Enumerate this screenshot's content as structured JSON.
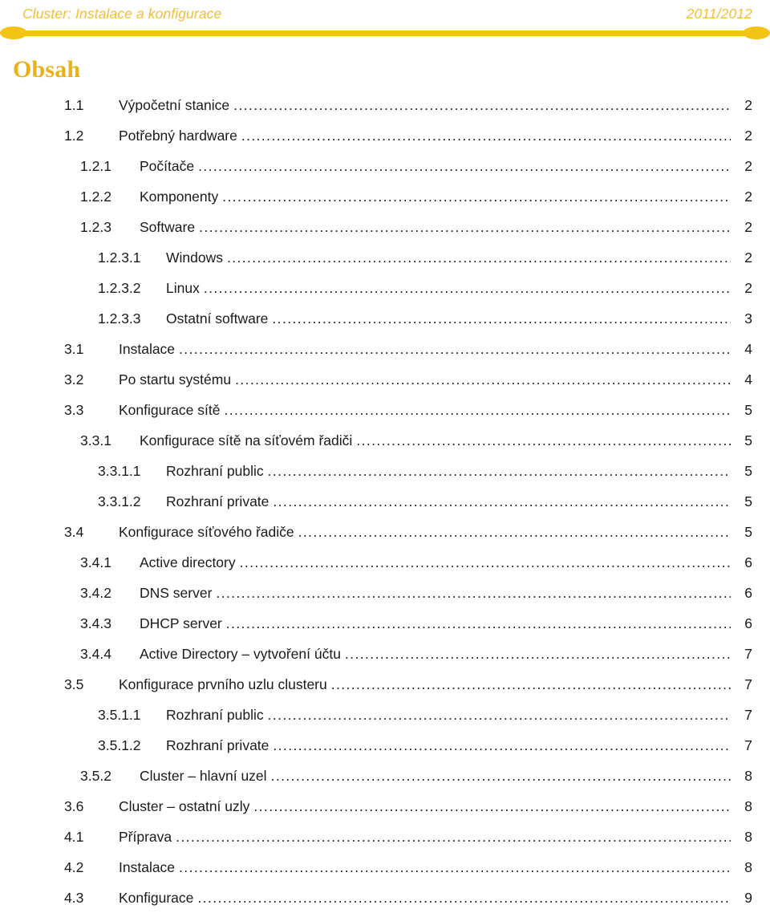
{
  "header": {
    "title": "Cluster: Instalace a konfigurace",
    "year": "2011/2012"
  },
  "toc": {
    "heading": "Obsah",
    "dot_leader": "........................................................................................................................................................................",
    "entries": [
      {
        "number": "1.1",
        "label": "Výpočetní stanice",
        "page": "2",
        "level": 2
      },
      {
        "number": "1.2",
        "label": "Potřebný hardware",
        "page": "2",
        "level": 2
      },
      {
        "number": "1.2.1",
        "label": "Počítače",
        "page": "2",
        "level": 3
      },
      {
        "number": "1.2.2",
        "label": "Komponenty",
        "page": "2",
        "level": 3
      },
      {
        "number": "1.2.3",
        "label": "Software",
        "page": "2",
        "level": 3
      },
      {
        "number": "1.2.3.1",
        "label": "Windows",
        "page": "2",
        "level": 4
      },
      {
        "number": "1.2.3.2",
        "label": "Linux",
        "page": "2",
        "level": 4
      },
      {
        "number": "1.2.3.3",
        "label": "Ostatní software",
        "page": "3",
        "level": 4
      },
      {
        "number": "3.1",
        "label": "Instalace",
        "page": "4",
        "level": 2
      },
      {
        "number": "3.2",
        "label": "Po startu systému",
        "page": "4",
        "level": 2
      },
      {
        "number": "3.3",
        "label": "Konfigurace sítě",
        "page": "5",
        "level": 2
      },
      {
        "number": "3.3.1",
        "label": "Konfigurace sítě na síťovém řadiči",
        "page": "5",
        "level": 3
      },
      {
        "number": "3.3.1.1",
        "label": "Rozhraní public",
        "page": "5",
        "level": 4
      },
      {
        "number": "3.3.1.2",
        "label": "Rozhraní private",
        "page": "5",
        "level": 4
      },
      {
        "number": "3.4",
        "label": "Konfigurace síťového řadiče",
        "page": "5",
        "level": 2
      },
      {
        "number": "3.4.1",
        "label": "Active directory",
        "page": "6",
        "level": 3
      },
      {
        "number": "3.4.2",
        "label": "DNS server",
        "page": "6",
        "level": 3
      },
      {
        "number": "3.4.3",
        "label": "DHCP server",
        "page": "6",
        "level": 3
      },
      {
        "number": "3.4.4",
        "label": "Active Directory – vytvoření účtu",
        "page": "7",
        "level": 3
      },
      {
        "number": "3.5",
        "label": "Konfigurace prvního uzlu clusteru",
        "page": "7",
        "level": 2
      },
      {
        "number": "3.5.1.1",
        "label": "Rozhraní public",
        "page": "7",
        "level": 4
      },
      {
        "number": "3.5.1.2",
        "label": "Rozhraní private",
        "page": "7",
        "level": 4
      },
      {
        "number": "3.5.2",
        "label": "Cluster – hlavní uzel",
        "page": "8",
        "level": 3
      },
      {
        "number": "3.6",
        "label": "Cluster – ostatní uzly",
        "page": "8",
        "level": 2
      },
      {
        "number": "4.1",
        "label": "Příprava",
        "page": "8",
        "level": 2
      },
      {
        "number": "4.2",
        "label": "Instalace",
        "page": "8",
        "level": 2
      },
      {
        "number": "4.3",
        "label": "Konfigurace",
        "page": "9",
        "level": 2
      }
    ]
  },
  "colors": {
    "accent": "#f3c316",
    "heading": "#e8b21c",
    "header_text": "#efc03a",
    "body_text": "#1a1a1a"
  }
}
